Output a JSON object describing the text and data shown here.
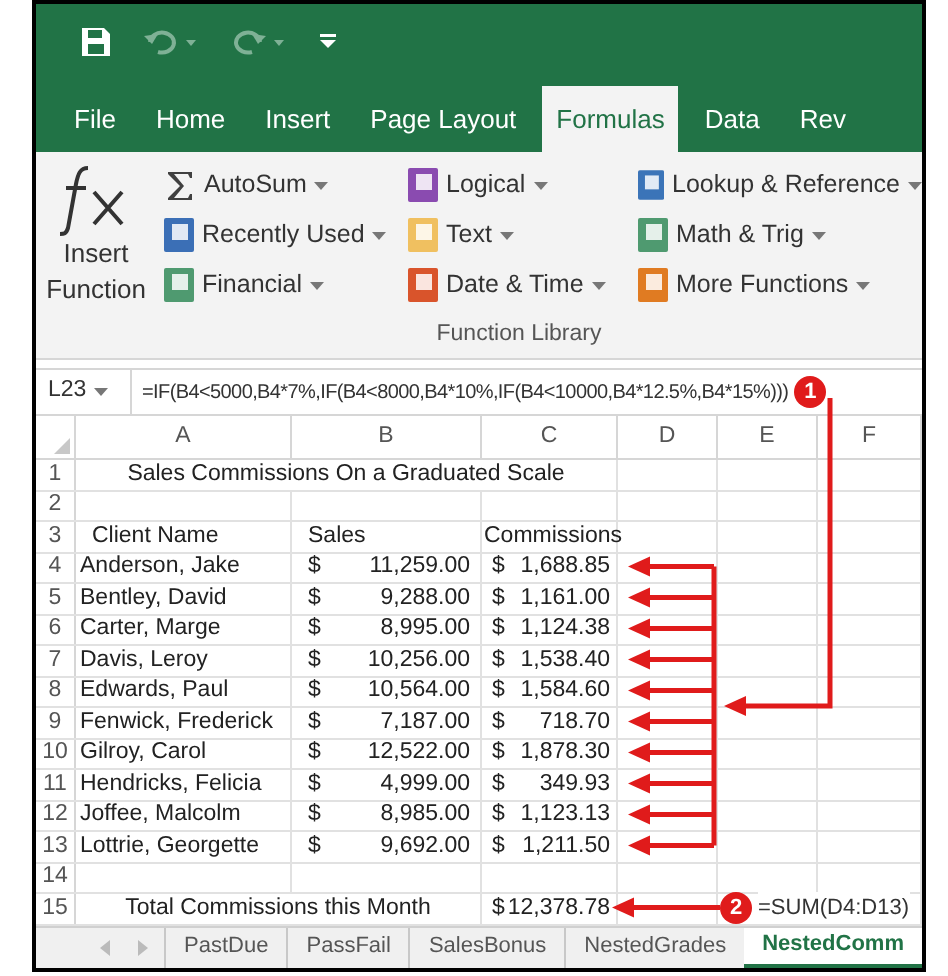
{
  "tabs": [
    {
      "label": "File",
      "selected": false
    },
    {
      "label": "Home",
      "selected": false
    },
    {
      "label": "Insert",
      "selected": false
    },
    {
      "label": "Page Layout",
      "selected": false
    },
    {
      "label": "Formulas",
      "selected": true
    },
    {
      "label": "Data",
      "selected": false
    },
    {
      "label": "Rev",
      "selected": false
    }
  ],
  "ribbon": {
    "insert_function": "Insert Function",
    "group_label": "Function Library",
    "columns": [
      [
        {
          "label": "AutoSum",
          "color": "#404040"
        },
        {
          "label": "Recently Used",
          "color": "#3b6fb6"
        },
        {
          "label": "Financial",
          "color": "#4f9a70"
        }
      ],
      [
        {
          "label": "Logical",
          "color": "#8a4bb0"
        },
        {
          "label": "Text",
          "color": "#f0c060"
        },
        {
          "label": "Date & Time",
          "color": "#d9542b"
        }
      ],
      [
        {
          "label": "Lookup & Reference",
          "color": "#3b74b8"
        },
        {
          "label": "Math & Trig",
          "color": "#4f9a70"
        },
        {
          "label": "More Functions",
          "color": "#e07b22"
        }
      ]
    ]
  },
  "formula_bar": {
    "name_box": "L23",
    "formula": "=IF(B4<5000,B4*7%,IF(B4<8000,B4*10%,IF(B4<10000,B4*12.5%,B4*15%)))"
  },
  "columns": [
    "A",
    "B",
    "C",
    "D",
    "E",
    "F"
  ],
  "rows": [
    {
      "number": "1",
      "kind": "title",
      "text": "Sales Commissions On a Graduated Scale"
    },
    {
      "number": "2",
      "kind": "blank"
    },
    {
      "number": "3",
      "kind": "header",
      "client_heading": "Client Name",
      "sales_heading": "Sales",
      "commission_heading": "Commissions"
    },
    {
      "number": "4",
      "kind": "data",
      "client": "Anderson, Jake",
      "sales_currency": "$",
      "sales": "11,259.00",
      "commission_currency": "$",
      "commission": "1,688.85"
    },
    {
      "number": "5",
      "kind": "data",
      "client": "Bentley, David",
      "sales_currency": "$",
      "sales": "9,288.00",
      "commission_currency": "$",
      "commission": "1,161.00"
    },
    {
      "number": "6",
      "kind": "data",
      "client": "Carter, Marge",
      "sales_currency": "$",
      "sales": "8,995.00",
      "commission_currency": "$",
      "commission": "1,124.38"
    },
    {
      "number": "7",
      "kind": "data",
      "client": "Davis, Leroy",
      "sales_currency": "$",
      "sales": "10,256.00",
      "commission_currency": "$",
      "commission": "1,538.40"
    },
    {
      "number": "8",
      "kind": "data",
      "client": "Edwards, Paul",
      "sales_currency": "$",
      "sales": "10,564.00",
      "commission_currency": "$",
      "commission": "1,584.60"
    },
    {
      "number": "9",
      "kind": "data",
      "client": "Fenwick, Frederick",
      "sales_currency": "$",
      "sales": "7,187.00",
      "commission_currency": "$",
      "commission": "718.70"
    },
    {
      "number": "10",
      "kind": "data",
      "client": "Gilroy, Carol",
      "sales_currency": "$",
      "sales": "12,522.00",
      "commission_currency": "$",
      "commission": "1,878.30"
    },
    {
      "number": "11",
      "kind": "data",
      "client": "Hendricks, Felicia",
      "sales_currency": "$",
      "sales": "4,999.00",
      "commission_currency": "$",
      "commission": "349.93"
    },
    {
      "number": "12",
      "kind": "data",
      "client": "Joffee, Malcolm",
      "sales_currency": "$",
      "sales": "8,985.00",
      "commission_currency": "$",
      "commission": "1,123.13"
    },
    {
      "number": "13",
      "kind": "data",
      "client": "Lottrie, Georgette",
      "sales_currency": "$",
      "sales": "9,692.00",
      "commission_currency": "$",
      "commission": "1,211.50"
    },
    {
      "number": "14",
      "kind": "blank"
    },
    {
      "number": "15",
      "kind": "total",
      "text": "Total Commissions this Month",
      "commission_currency": "$",
      "commission": "12,378.78"
    }
  ],
  "annotations": {
    "badge_1": "1",
    "badge_2": "2",
    "note_2": "=SUM(D4:D13)"
  },
  "sheet_tabs": [
    {
      "label": "PastDue",
      "selected": false
    },
    {
      "label": "PassFail",
      "selected": false
    },
    {
      "label": "SalesBonus",
      "selected": false
    },
    {
      "label": "NestedGrades",
      "selected": false
    },
    {
      "label": "NestedComm",
      "selected": true
    }
  ]
}
